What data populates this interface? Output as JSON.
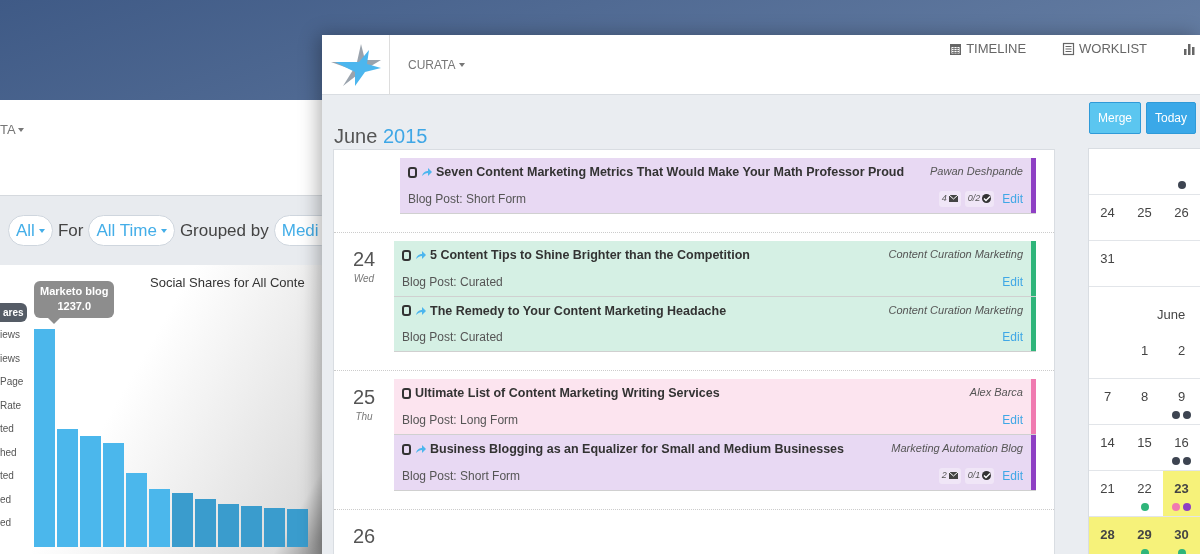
{
  "back_window": {
    "brand": "TA",
    "filters": [
      {
        "kind": "pill",
        "text": "All"
      },
      {
        "kind": "word",
        "text": "For"
      },
      {
        "kind": "pill",
        "text": "All Time"
      },
      {
        "kind": "word",
        "text": "Grouped by"
      },
      {
        "kind": "pill",
        "text": "Medi"
      }
    ],
    "chart": {
      "title": "Social Shares for All Conte",
      "legend": "ares",
      "tooltip_title": "Marketo blog",
      "tooltip_value": "1237.0",
      "row_labels": [
        "iews",
        "iews",
        "Page",
        "Rate",
        "ted",
        "hed",
        "ted",
        "ed",
        "ed"
      ]
    }
  },
  "front_window": {
    "brand": "CURATA",
    "nav": [
      {
        "kind": "link",
        "label": "TIMELINE"
      },
      {
        "kind": "link",
        "label": "WORKLIST"
      },
      {
        "kind": "icon_only"
      }
    ],
    "month": "June",
    "year": "2015",
    "buttons": [
      {
        "label": "Merge",
        "kind": "light"
      },
      {
        "label": "Today",
        "kind": "primary"
      }
    ],
    "agenda": [
      {
        "events": [
          {
            "title": "Seven Content Marketing Metrics That Would Make Your Math Professor Proud",
            "type": "Blog Post: Short Form",
            "owner": "Pawan Deshpande",
            "comments": "4",
            "tasks": "0/2",
            "edit": "Edit",
            "color": "#8e3fc4",
            "shared": true
          }
        ]
      },
      {
        "day": "24",
        "weekday": "Wed",
        "events": [
          {
            "title": "5 Content Tips to Shine Brighter than the Competition",
            "type": "Blog Post: Curated",
            "owner": "Content Curation Marketing",
            "edit": "Edit",
            "color": "#2fb57a",
            "shared": true
          },
          {
            "title": "The Remedy to Your Content Marketing Headache",
            "type": "Blog Post: Curated",
            "owner": "Content Curation Marketing",
            "edit": "Edit",
            "color": "#2fb57a",
            "shared": true
          }
        ]
      },
      {
        "day": "25",
        "weekday": "Thu",
        "events": [
          {
            "title": "Ultimate List of Content Marketing Writing Services",
            "type": "Blog Post: Long Form",
            "owner": "Alex Barca",
            "edit": "Edit",
            "color": "#f07ab0",
            "shared": false
          },
          {
            "title": "Business Blogging as an Equalizer for Small and Medium Businesses",
            "type": "Blog Post: Short Form",
            "owner": "Marketing Automation Blog",
            "comments": "2",
            "tasks": "0/1",
            "edit": "Edit",
            "color": "#8e3fc4",
            "shared": true
          }
        ]
      },
      {
        "day": "26"
      }
    ],
    "calendar": [
      {
        "kind": "week",
        "days": [
          {
            "highlighted": false
          },
          {
            "highlighted": false
          },
          {
            "highlighted": false,
            "dots": [
              {
                "color": "#3d4451"
              }
            ]
          }
        ]
      },
      {
        "kind": "week",
        "days": [
          {
            "label": "24",
            "highlighted": false
          },
          {
            "label": "25",
            "highlighted": false
          },
          {
            "label": "26",
            "highlighted": false
          }
        ]
      },
      {
        "kind": "week",
        "days": [
          {
            "label": "31",
            "highlighted": false
          },
          {
            "highlighted": false
          },
          {
            "highlighted": false
          }
        ]
      },
      {
        "kind": "month",
        "label": "June"
      },
      {
        "kind": "week",
        "days": [
          {
            "highlighted": false
          },
          {
            "label": "1",
            "highlighted": false
          },
          {
            "label": "2",
            "highlighted": false
          }
        ]
      },
      {
        "kind": "week",
        "days": [
          {
            "label": "7",
            "highlighted": false
          },
          {
            "label": "8",
            "highlighted": false
          },
          {
            "label": "9",
            "highlighted": false,
            "dots": [
              {
                "color": "#3d4451"
              },
              {
                "color": "#3d4451"
              }
            ]
          }
        ]
      },
      {
        "kind": "week",
        "days": [
          {
            "label": "14",
            "highlighted": false
          },
          {
            "label": "15",
            "highlighted": false
          },
          {
            "label": "16",
            "highlighted": false,
            "dots": [
              {
                "color": "#3d4451"
              },
              {
                "color": "#3d4451"
              }
            ]
          }
        ]
      },
      {
        "kind": "week",
        "days": [
          {
            "label": "21",
            "highlighted": false
          },
          {
            "label": "22",
            "highlighted": false,
            "dots": [
              {
                "color": "#2fb57a"
              }
            ]
          },
          {
            "label": "23",
            "highlighted": true,
            "dots": [
              {
                "color": "#f07ab0"
              },
              {
                "color": "#8e3fc4"
              }
            ]
          }
        ]
      },
      {
        "kind": "week",
        "days": [
          {
            "label": "28",
            "highlighted": true
          },
          {
            "label": "29",
            "highlighted": true,
            "dots": [
              {
                "color": "#2fb57a"
              }
            ]
          },
          {
            "label": "30",
            "highlighted": true,
            "dots": [
              {
                "color": "#2fb57a"
              }
            ]
          }
        ]
      }
    ]
  }
}
